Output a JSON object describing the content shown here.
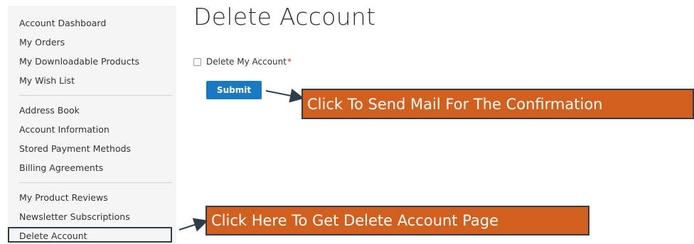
{
  "sidebar": {
    "items": [
      {
        "label": "Account Dashboard"
      },
      {
        "label": "My Orders"
      },
      {
        "label": "My Downloadable Products"
      },
      {
        "label": "My Wish List"
      },
      {
        "label": "Address Book"
      },
      {
        "label": "Account Information"
      },
      {
        "label": "Stored Payment Methods"
      },
      {
        "label": "Billing Agreements"
      },
      {
        "label": "My Product Reviews"
      },
      {
        "label": "Newsletter Subscriptions"
      },
      {
        "label": "Delete Account"
      }
    ]
  },
  "main": {
    "title": "Delete Account",
    "checkbox_label": "Delete My Account",
    "required_mark": "*",
    "submit_label": "Submit"
  },
  "annotations": {
    "submit_callout": "Click To Send Mail For The Confirmation",
    "delete_callout": "Click Here To Get Delete Account Page"
  },
  "colors": {
    "accent": "#1979c3",
    "callout_bg": "#d35f1f",
    "callout_border": "#2d3e4a",
    "required": "#e02b27"
  }
}
